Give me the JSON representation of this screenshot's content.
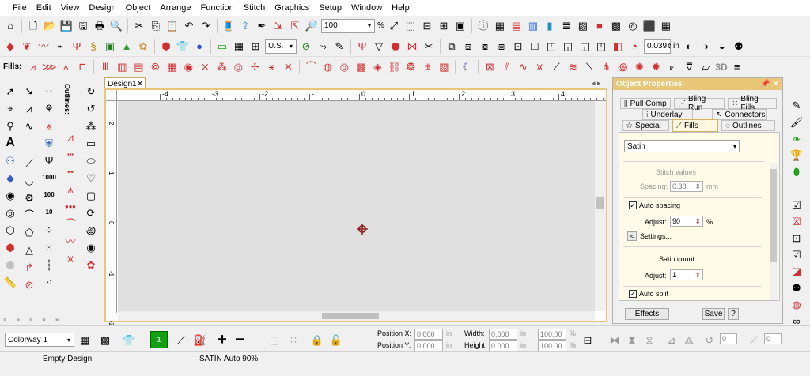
{
  "menu": [
    "File",
    "Edit",
    "View",
    "Design",
    "Object",
    "Arrange",
    "Function",
    "Stitch",
    "Graphics",
    "Setup",
    "Window",
    "Help"
  ],
  "toolbar": {
    "zoom_value": "100",
    "zoom_unit": "%",
    "units_value": "U.S.",
    "stitch_length_value": "0.039",
    "stitch_length_unit": "in",
    "fills_label": "Fills:",
    "threed_label": "3D"
  },
  "left_panel": {
    "outlines_label": "Outlines:",
    "density_labels": [
      "1000",
      "100",
      "10"
    ]
  },
  "document": {
    "tab_label": "Design1",
    "ruler_labels": [
      "-4",
      "-3",
      "-2",
      "-1",
      "0",
      "1",
      "2",
      "3",
      "4"
    ],
    "vruler_labels": [
      "2",
      "1",
      "0",
      "-1",
      "-2"
    ]
  },
  "object_properties": {
    "title": "Object Properties",
    "tabs_row1": [
      "Pull Comp",
      "Bling Run",
      "Bling Fills"
    ],
    "tabs_row2": [
      "Underlay",
      "Connectors"
    ],
    "tabs_row3": [
      "Special",
      "Fills",
      "Outlines"
    ],
    "active_tab": "Fills",
    "fill_type": "Satin",
    "stitch_values_label": "Stitch values",
    "spacing_label": "Spacing:",
    "spacing_value": "0.38",
    "spacing_unit": "mm",
    "auto_spacing_label": "Auto spacing",
    "auto_spacing_checked": true,
    "adjust_label": "Adjust:",
    "adjust_value": "90",
    "adjust_unit": "%",
    "settings_label": "Settings...",
    "satin_count_label": "Satin count",
    "satin_adjust_label": "Adjust:",
    "satin_adjust_value": "1",
    "auto_split_label": "Auto split",
    "auto_split_checked": true,
    "effects_button": "Effects",
    "save_button": "Save",
    "help_button": "?"
  },
  "bottom": {
    "colorway_value": "Colorway 1",
    "color_number": "1",
    "position_x_label": "Position X:",
    "position_y_label": "Position Y:",
    "position_x_value": "0.000",
    "position_y_value": "0.000",
    "pos_unit": "in",
    "width_label": "Width:",
    "height_label": "Height:",
    "width_value": "0.000",
    "height_value": "0.000",
    "size_unit": "in",
    "scale_w_value": "100.00",
    "scale_h_value": "100.00",
    "scale_unit": "%",
    "rotate_value": "0",
    "slant_value": "0"
  },
  "status": {
    "left": "Empty Design",
    "middle": "SATIN Auto 90%"
  },
  "colors": {
    "accent": "#e8c878",
    "red": "#d03030",
    "green_swatch": "#10a010",
    "canvas": "#e0e0e0"
  }
}
